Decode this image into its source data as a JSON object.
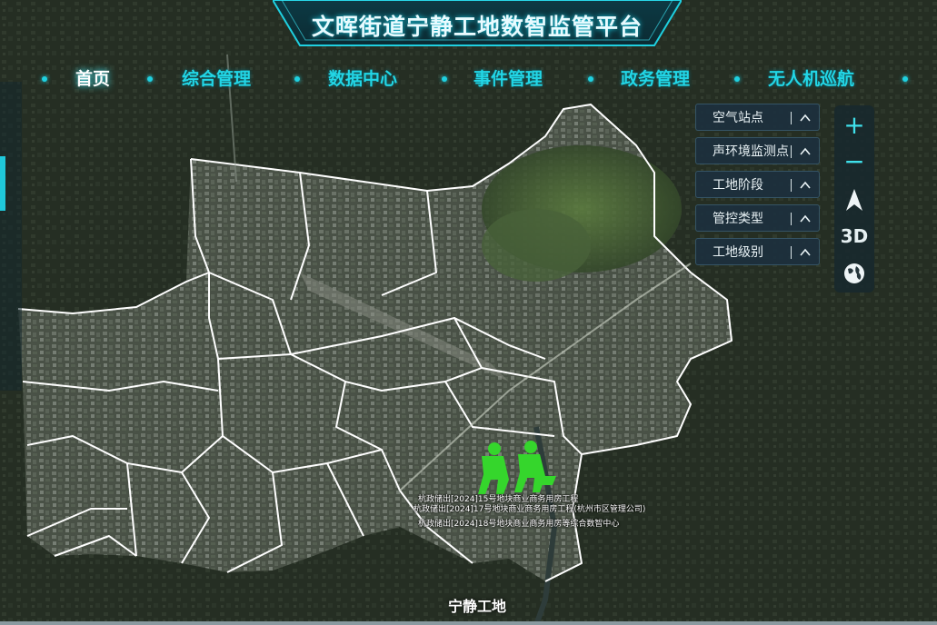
{
  "header": {
    "title": "文晖街道宁静工地数智监管平台"
  },
  "nav": {
    "items": [
      {
        "label": "首页",
        "active": true
      },
      {
        "label": "综合管理",
        "active": false
      },
      {
        "label": "数据中心",
        "active": false
      },
      {
        "label": "事件管理",
        "active": false
      },
      {
        "label": "政务管理",
        "active": false
      },
      {
        "label": "无人机巡航",
        "active": false
      }
    ]
  },
  "layers": {
    "items": [
      {
        "label": "空气站点"
      },
      {
        "label": "声环境监测点"
      },
      {
        "label": "工地阶段"
      },
      {
        "label": "管控类型"
      },
      {
        "label": "工地级别"
      }
    ]
  },
  "tools": {
    "zoom_in": "+",
    "zoom_out": "−",
    "threeD": "3D"
  },
  "map": {
    "site_labels": [
      "杭政储出[2024]15号地块商业商务用房工程",
      "杭政储出[2024]17号地块商业商务用房工程(杭州市区管理公司)",
      "杭政储出[2024]18号地块商业商务用房等综合数智中心"
    ],
    "bottom_label": "宁静工地"
  },
  "colors": {
    "accent": "#22d6e6",
    "site_marker": "#35d62c",
    "boundary": "#ffffff"
  }
}
